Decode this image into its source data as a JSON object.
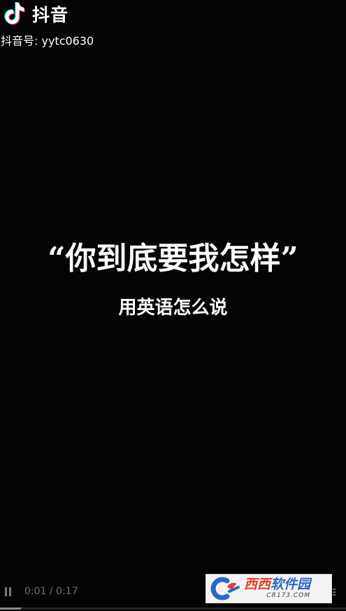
{
  "watermark": {
    "brand": "抖音",
    "account_id": "抖音号: yytc0630",
    "logo_icon": "tiktok-note-icon",
    "logo_colors": {
      "cyan": "#25F4EE",
      "red": "#FE2C55",
      "white": "#FFFFFF"
    }
  },
  "video": {
    "title": "“你到底要我怎样”",
    "subtitle": "用英语怎么说",
    "background": "#050306"
  },
  "player": {
    "state_icon": "pause-icon",
    "time": "0:01 / 0:17",
    "progress": 0.06,
    "more_icon": "more-icon"
  },
  "site_badge": {
    "name_part1": "西西",
    "name_part2": "软件园",
    "domain": "CR173.COM",
    "logo_icon": "cr-logo-icon",
    "colors": {
      "blue": "#2B67C9",
      "red": "#E4402F"
    }
  }
}
